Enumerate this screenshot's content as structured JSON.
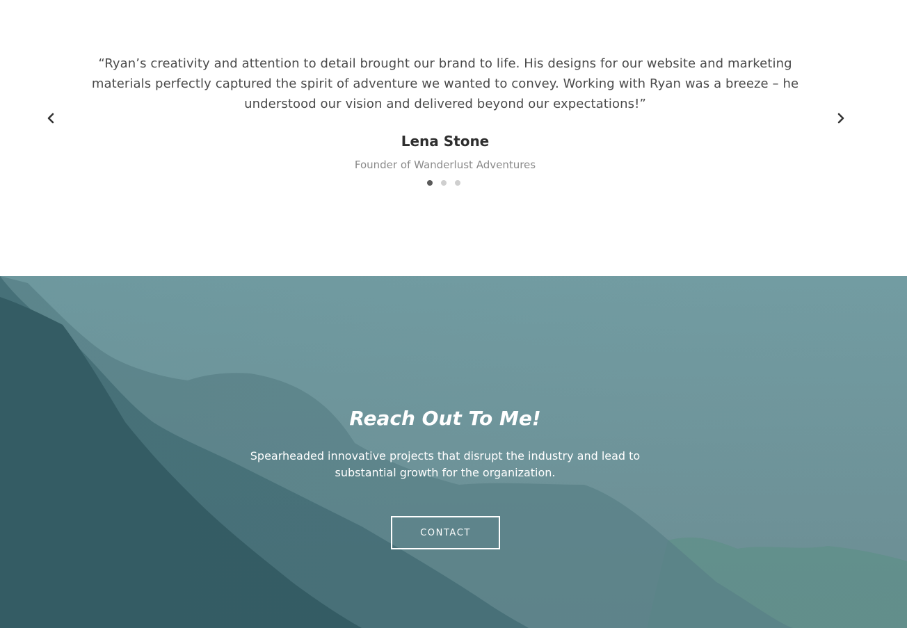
{
  "testimonial": {
    "quote": "“Ryan’s creativity and attention to detail brought our brand to life. His designs for our website and marketing materials perfectly captured the spirit of adventure we wanted to convey. Working with Ryan was a breeze – he understood our vision and delivered beyond our expectations!”",
    "author_name": "Lena Stone",
    "author_title": "Founder of Wanderlust Adventures",
    "slide_count": 3,
    "active_slide": 1,
    "prev_icon": "chevron-left-icon",
    "next_icon": "chevron-right-icon"
  },
  "cta": {
    "title": "Reach Out To Me!",
    "text": "Spearheaded innovative projects that disrupt the industry and lead to substantial growth for the organization.",
    "button_label": "CONTACT",
    "background_image": "misty-mountains"
  },
  "colors": {
    "quote_text": "#4a4a4a",
    "author_name": "#2e2e2e",
    "author_title": "#8a8a8a",
    "dot_active": "#5a5a5a",
    "dot_inactive": "#cfcfcf",
    "cta_sky": "#6f9aa0",
    "cta_text": "#ffffff"
  }
}
